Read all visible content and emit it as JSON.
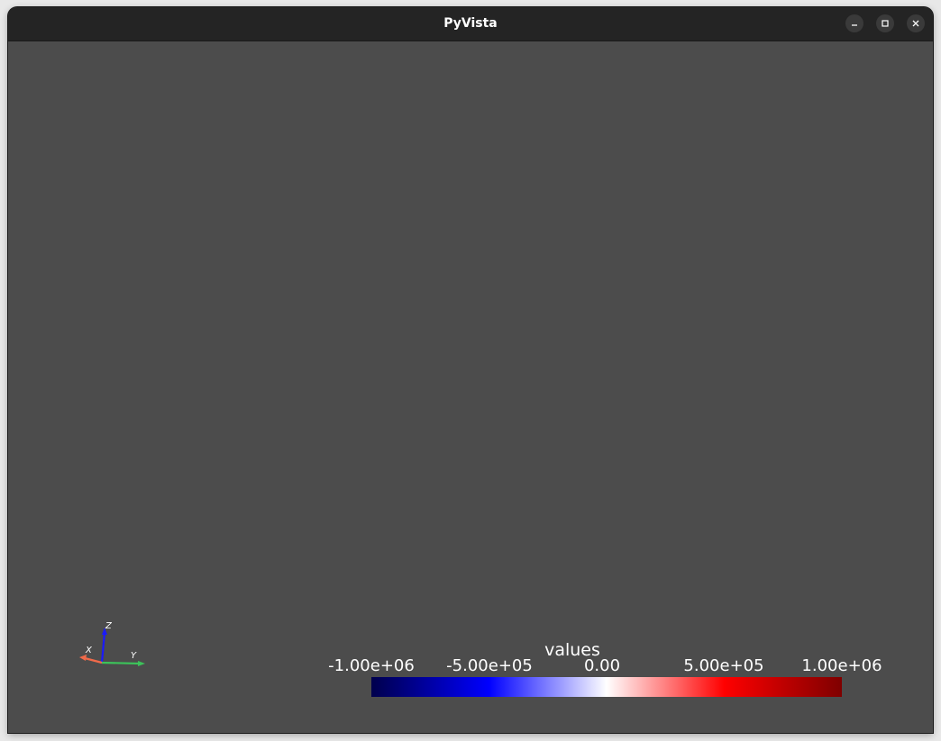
{
  "window": {
    "title": "PyVista",
    "controls": {
      "minimize_icon": "minimize-icon",
      "maximize_icon": "maximize-icon",
      "close_icon": "close-icon"
    }
  },
  "viewport": {
    "background_color": "#4c4c4c",
    "axes_widget": {
      "labels": {
        "x": "X",
        "y": "Y",
        "z": "Z"
      },
      "colors": {
        "x": "#f06a4a",
        "y": "#3cc25a",
        "z": "#1a1aff"
      }
    },
    "scalar_bar": {
      "title": "values",
      "colormap": "seismic",
      "colors": [
        "#00004c",
        "#0000ff",
        "#ffffff",
        "#ff0000",
        "#7f0000"
      ],
      "tick_labels": [
        "-1.00e+06",
        "-5.00e+05",
        "0.00",
        "5.00e+05",
        "1.00e+06"
      ],
      "range": [
        -1000000,
        1000000
      ]
    }
  }
}
